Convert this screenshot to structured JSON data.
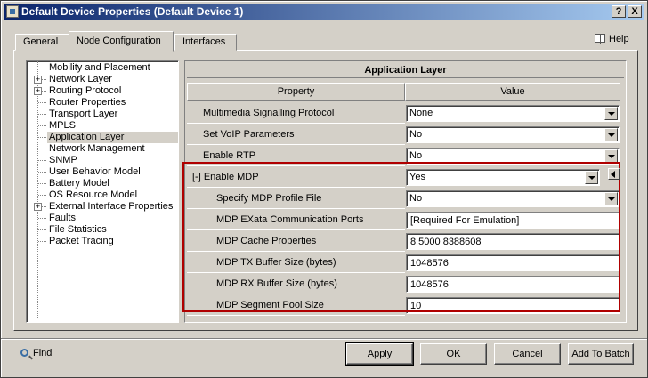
{
  "window": {
    "title": "Default Device Properties (Default Device 1)"
  },
  "titlebar_buttons": {
    "help": "?",
    "close": "X"
  },
  "tabs": [
    {
      "label": "General"
    },
    {
      "label": "Node Configuration",
      "active": true
    },
    {
      "label": "Interfaces"
    }
  ],
  "help": {
    "label": "Help",
    "icon": "book-icon"
  },
  "tree": {
    "items": [
      {
        "label": "Mobility and Placement",
        "expandable": false
      },
      {
        "label": "Network Layer",
        "expandable": true
      },
      {
        "label": "Routing Protocol",
        "expandable": true
      },
      {
        "label": "Router Properties",
        "expandable": false
      },
      {
        "label": "Transport Layer",
        "expandable": false
      },
      {
        "label": "MPLS",
        "expandable": false
      },
      {
        "label": "Application Layer",
        "expandable": false,
        "selected": true
      },
      {
        "label": "Network Management",
        "expandable": false
      },
      {
        "label": "SNMP",
        "expandable": false
      },
      {
        "label": "User Behavior Model",
        "expandable": false
      },
      {
        "label": "Battery Model",
        "expandable": false
      },
      {
        "label": "OS Resource Model",
        "expandable": false
      },
      {
        "label": "External Interface Properties",
        "expandable": true
      },
      {
        "label": "Faults",
        "expandable": false
      },
      {
        "label": "File Statistics",
        "expandable": false
      },
      {
        "label": "Packet Tracing",
        "expandable": false
      }
    ]
  },
  "grid": {
    "title": "Application Layer",
    "col_property": "Property",
    "col_value": "Value",
    "rows": [
      {
        "label": "Multimedia Signalling Protocol",
        "value": "None",
        "type": "combo",
        "indent": 1
      },
      {
        "label": "Set VoIP Parameters",
        "value": "No",
        "type": "combo",
        "indent": 1
      },
      {
        "label": "Enable RTP",
        "value": "No",
        "type": "combo",
        "indent": 1
      },
      {
        "label": "[-] Enable MDP",
        "value": "Yes",
        "type": "combo",
        "indent": 0
      },
      {
        "label": "Specify MDP Profile File",
        "value": "No",
        "type": "combo",
        "indent": 2
      },
      {
        "label": "MDP EXata Communication Ports",
        "value": "[Required For Emulation]",
        "type": "text",
        "indent": 2
      },
      {
        "label": "MDP Cache Properties",
        "value": "8 5000 8388608",
        "type": "text",
        "indent": 2
      },
      {
        "label": "MDP TX Buffer Size (bytes)",
        "value": "1048576",
        "type": "text",
        "indent": 2
      },
      {
        "label": "MDP RX Buffer Size (bytes)",
        "value": "1048576",
        "type": "text",
        "indent": 2
      },
      {
        "label": "MDP Segment Pool Size",
        "value": "10",
        "type": "text",
        "indent": 2
      }
    ]
  },
  "footer": {
    "find_label": "Find",
    "apply_label": "Apply",
    "ok_label": "OK",
    "cancel_label": "Cancel",
    "add_to_batch_label": "Add To Batch"
  },
  "colors": {
    "highlight_border": "#b00000",
    "title_gradient_start": "#0a246a"
  }
}
